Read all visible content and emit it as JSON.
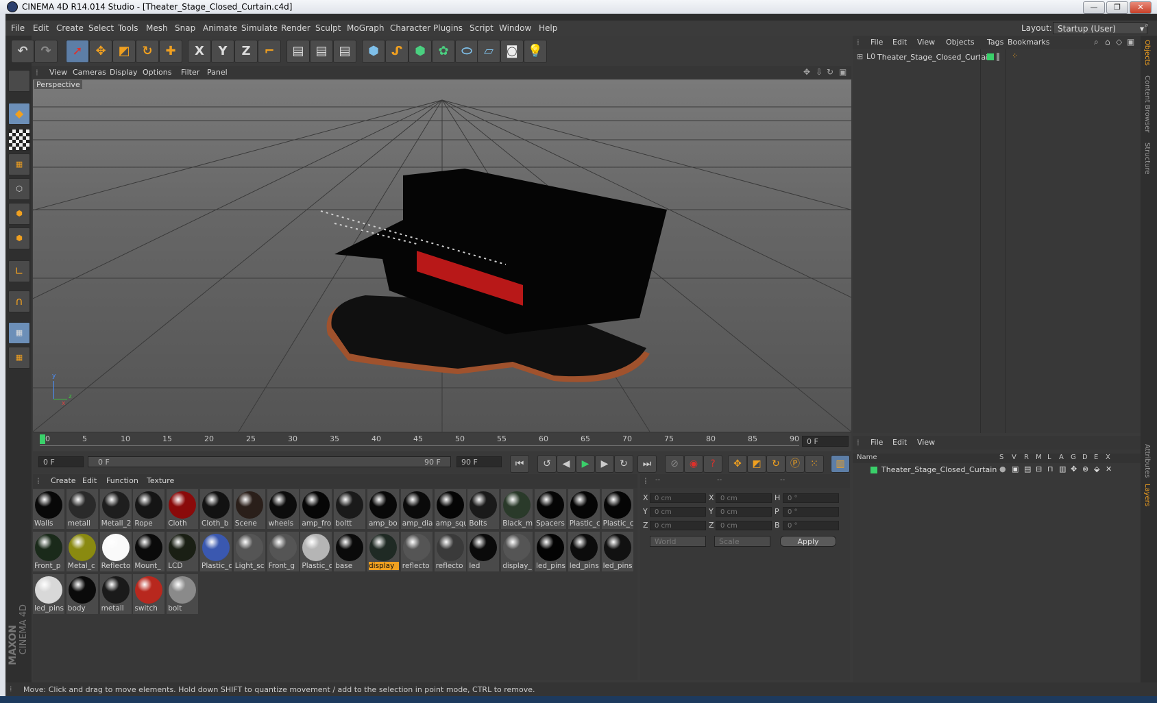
{
  "window": {
    "title": "CINEMA 4D R14.014 Studio - [Theater_Stage_Closed_Curtain.c4d]",
    "minimize": "—",
    "restore": "❐",
    "close": "✕"
  },
  "menubar": {
    "items": [
      "File",
      "Edit",
      "Create",
      "Select",
      "Tools",
      "Mesh",
      "Snap",
      "Animate",
      "Simulate",
      "Render",
      "Sculpt",
      "MoGraph",
      "Character",
      "Plugins",
      "Script",
      "Window",
      "Help"
    ],
    "layout_label": "Layout:",
    "layout_value": "Startup (User)"
  },
  "toolbar": {
    "x_label": "X",
    "y_label": "Y",
    "z_label": "Z"
  },
  "viewport": {
    "menu": [
      "View",
      "Cameras",
      "Display",
      "Options",
      "Filter",
      "Panel"
    ],
    "label": "Perspective",
    "axis_x": "x",
    "axis_y": "y",
    "axis_z": "z"
  },
  "timeline": {
    "ticks": [
      "0",
      "5",
      "10",
      "15",
      "20",
      "25",
      "30",
      "35",
      "40",
      "45",
      "50",
      "55",
      "60",
      "65",
      "70",
      "75",
      "80",
      "85",
      "90"
    ],
    "current_frame": "0 F",
    "start_field": "0 F",
    "range_start": "0 F",
    "range_end": "90 F",
    "end_field": "90 F"
  },
  "materials": {
    "menu": [
      "Create",
      "Edit",
      "Function",
      "Texture"
    ],
    "items": [
      {
        "label": "Walls",
        "color": "#080808"
      },
      {
        "label": "metall",
        "color": "#2a2a2a"
      },
      {
        "label": "Metall_2",
        "color": "#1e1e1e"
      },
      {
        "label": "Rope",
        "color": "#151515"
      },
      {
        "label": "Cloth",
        "color": "#8a0a0a"
      },
      {
        "label": "Cloth_b",
        "color": "#121212"
      },
      {
        "label": "Scene",
        "color": "#2a1f1a"
      },
      {
        "label": "wheels",
        "color": "#0c0c0c"
      },
      {
        "label": "amp_fro",
        "color": "#060606"
      },
      {
        "label": "boltt",
        "color": "#1a1a1a"
      },
      {
        "label": "amp_bo",
        "color": "#080808"
      },
      {
        "label": "amp_dia",
        "color": "#0a0a0a"
      },
      {
        "label": "amp_squ",
        "color": "#050505"
      },
      {
        "label": "Bolts",
        "color": "#1a1a1a"
      },
      {
        "label": "Black_m",
        "color": "#2a3a2a"
      },
      {
        "label": "Spacers",
        "color": "#050505"
      },
      {
        "label": "Plastic_c",
        "color": "#050505"
      },
      {
        "label": "Plastic_c",
        "color": "#050505"
      },
      {
        "label": "Front_p",
        "color": "#1a2a1a"
      },
      {
        "label": "Metal_c",
        "color": "#8a8a10"
      },
      {
        "label": "Reflecto",
        "color": "#fafafa"
      },
      {
        "label": "Mount_",
        "color": "#0a0a0a"
      },
      {
        "label": "LCD",
        "color": "#1a1f14"
      },
      {
        "label": "Plastic_c",
        "color": "#3a58b0"
      },
      {
        "label": "Light_sc",
        "color": "#555555"
      },
      {
        "label": "Front_g",
        "color": "#555555"
      },
      {
        "label": "Plastic_c",
        "color": "#b5b5b5"
      },
      {
        "label": "base",
        "color": "#0a0a0a"
      },
      {
        "label": "display",
        "color": "#1f2a24"
      },
      {
        "label": "reflecto",
        "color": "#555555"
      },
      {
        "label": "reflecto",
        "color": "#3a3a3a"
      },
      {
        "label": "led",
        "color": "#0a0a0a"
      },
      {
        "label": "display_",
        "color": "#555555"
      },
      {
        "label": "led_pins",
        "color": "#030303"
      },
      {
        "label": "led_pins",
        "color": "#0c0c0c"
      },
      {
        "label": "led_pins",
        "color": "#111111"
      },
      {
        "label": "led_pins",
        "color": "#d8d8d8"
      },
      {
        "label": "body",
        "color": "#0a0a0a"
      },
      {
        "label": "metall",
        "color": "#1a1a1a"
      },
      {
        "label": "switch",
        "color": "#b8281e"
      },
      {
        "label": "bolt",
        "color": "#8a8a8a"
      }
    ],
    "highlight_index": 28
  },
  "attributes": {
    "header": [
      "--",
      "--",
      "--"
    ],
    "rows": [
      {
        "a": "X",
        "av": "0 cm",
        "b": "X",
        "bv": "0 cm",
        "c": "H",
        "cv": "0 °"
      },
      {
        "a": "Y",
        "av": "0 cm",
        "b": "Y",
        "bv": "0 cm",
        "c": "P",
        "cv": "0 °"
      },
      {
        "a": "Z",
        "av": "0 cm",
        "b": "Z",
        "bv": "0 cm",
        "c": "B",
        "cv": "0 °"
      }
    ],
    "coord_mode": "World",
    "scale_mode": "Scale",
    "apply": "Apply"
  },
  "objects": {
    "menu": [
      "File",
      "Edit",
      "View",
      "Objects",
      "Tags",
      "Bookmarks"
    ],
    "item": "Theater_Stage_Closed_Curtain",
    "item_prefix": "L0"
  },
  "layers": {
    "menu": [
      "File",
      "Edit",
      "View"
    ],
    "columns_name": "Name",
    "columns": [
      "S",
      "V",
      "R",
      "M",
      "L",
      "A",
      "G",
      "D",
      "E",
      "X"
    ],
    "item": "Theater_Stage_Closed_Curtain"
  },
  "right_tabs": [
    "Objects",
    "Content Browser",
    "Structure",
    "Attributes",
    "Layers"
  ],
  "branding": {
    "maxon": "MAXON",
    "c4d": "CINEMA 4D"
  },
  "status": "Move: Click and drag to move elements. Hold down SHIFT to quantize movement / add to the selection in point mode, CTRL to remove."
}
